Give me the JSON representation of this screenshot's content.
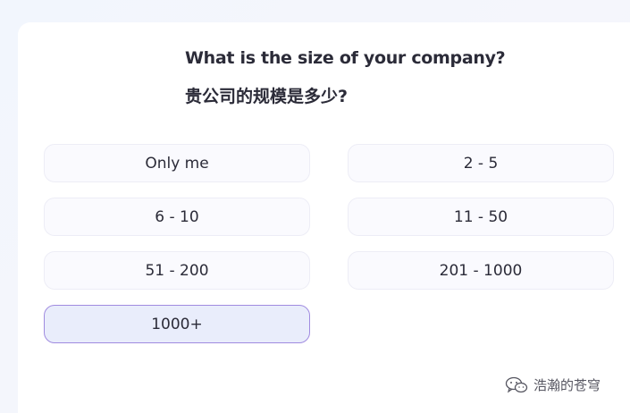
{
  "question": {
    "english": "What is the size of your company?",
    "chinese": "贵公司的规模是多少?"
  },
  "options": [
    {
      "label": "Only me",
      "selected": false
    },
    {
      "label": "2 - 5",
      "selected": false
    },
    {
      "label": "6 - 10",
      "selected": false
    },
    {
      "label": "11 - 50",
      "selected": false
    },
    {
      "label": "51 - 200",
      "selected": false
    },
    {
      "label": "201 - 1000",
      "selected": false
    },
    {
      "label": "1000+",
      "selected": true
    }
  ],
  "watermark": {
    "icon": "wechat-icon",
    "text": "浩瀚的苍穹"
  },
  "colors": {
    "selected_border": "#a08be0",
    "selected_background": "#e9edfb",
    "option_background": "#fafafe",
    "text": "#2b2b38"
  }
}
